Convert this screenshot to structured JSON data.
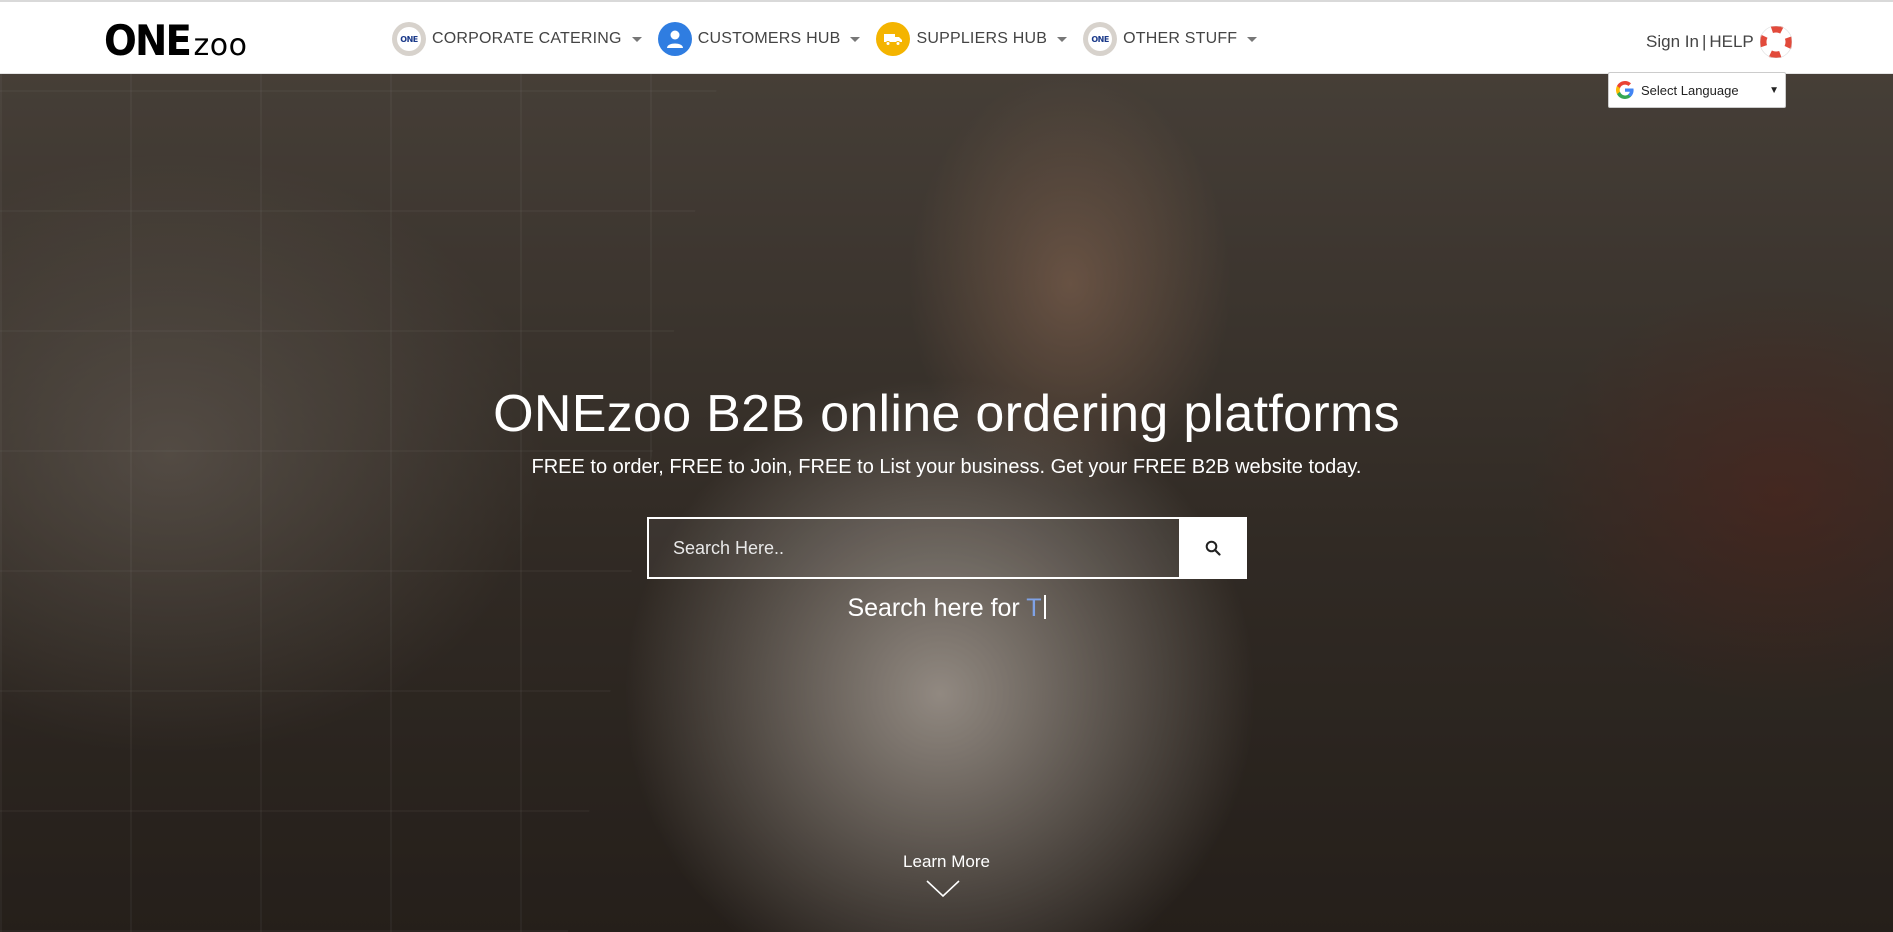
{
  "header": {
    "logo": {
      "one": "ONE",
      "zoo": "zoo"
    },
    "nav": [
      {
        "label": "CORPORATE CATERING",
        "icon": "one-logo-icon"
      },
      {
        "label": "CUSTOMERS HUB",
        "icon": "user-icon"
      },
      {
        "label": "SUPPLIERS HUB",
        "icon": "truck-icon"
      },
      {
        "label": "OTHER STUFF",
        "icon": "one-logo-icon"
      }
    ],
    "one_badge": "ONE",
    "sign_in": "Sign In",
    "separator": "|",
    "help": "HELP"
  },
  "language": {
    "label": "Select Language"
  },
  "hero": {
    "title": "ONEzoo B2B online ordering platforms",
    "subtitle": "FREE to order, FREE to Join, FREE to List your business. Get your FREE B2B website today.",
    "search": {
      "placeholder": "Search Here..",
      "value": ""
    },
    "typing_prefix": "Search here for",
    "typing_value": "T",
    "learn_more": "Learn More"
  },
  "colors": {
    "accent_blue": "#2f7de1",
    "accent_yellow": "#f4b400",
    "typed_text": "#7fa2e6"
  }
}
